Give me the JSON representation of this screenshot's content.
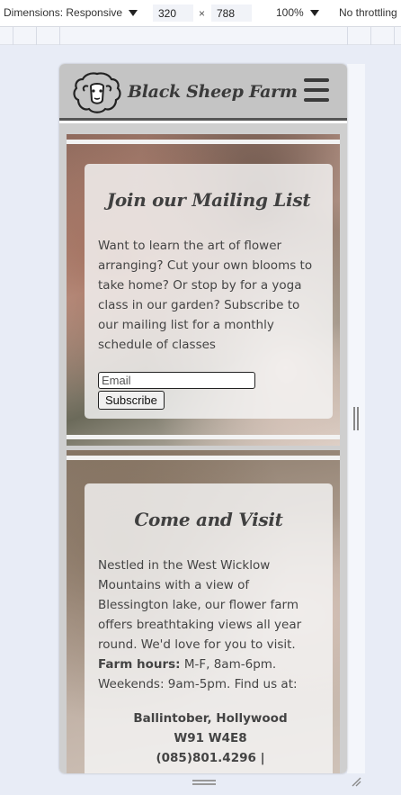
{
  "devtools": {
    "dimensions_label": "Dimensions: Responsive",
    "width_value": "320",
    "times_symbol": "×",
    "height_value": "788",
    "zoom_label": "100%",
    "throttling_label": "No throttling"
  },
  "site": {
    "brand_name": "Black Sheep Farm",
    "header_color": "#c4c4c4"
  },
  "mailing": {
    "title": "Join our Mailing List",
    "body": "Want to learn the art of flower arranging? Cut your own blooms to take home? Or stop by for a yoga class in our garden? Subscribe to our mailing list for a monthly schedule of classes",
    "email_placeholder": "Email",
    "subscribe_label": "Subscribe"
  },
  "visit": {
    "title": "Come and Visit",
    "body": "Nestled in the West Wicklow Mountains with a view of Blessington lake, our flower farm offers breathtaking views all year round. We'd love for you to visit.",
    "hours_label": "Farm hours:",
    "hours_text": " M-F, 8am-6pm. Weekends: 9am-5pm. Find us at:",
    "address_line1": "Ballintober, Hollywood",
    "address_line2": "W91 W4E8",
    "phone": "(085)801.4296 |"
  }
}
